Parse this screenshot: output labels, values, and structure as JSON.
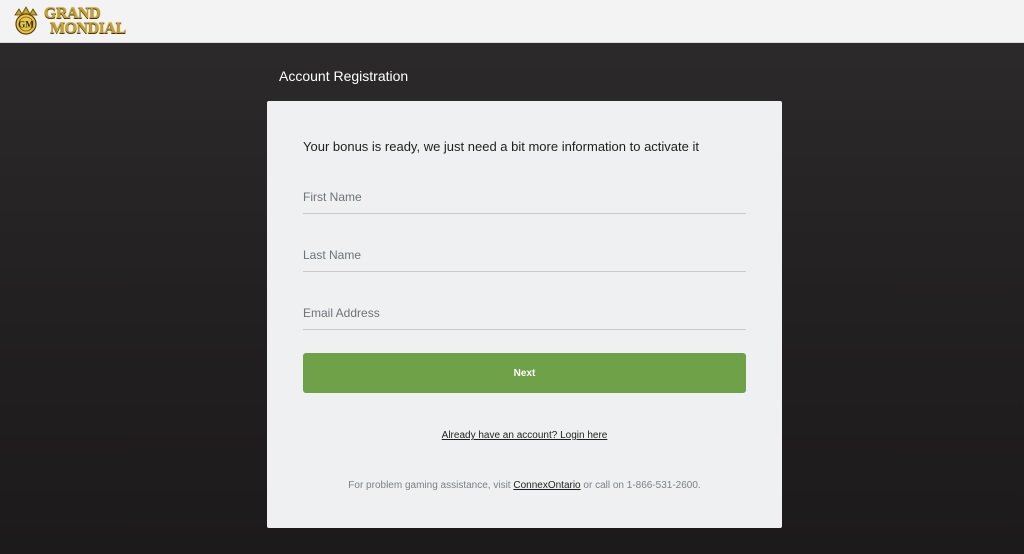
{
  "brand": {
    "logo_line1": "GRAND",
    "logo_line2": "MONDIAL",
    "gold_color": "#c9a227"
  },
  "page": {
    "heading": "Account Registration"
  },
  "form": {
    "intro": "Your bonus is ready, we just need a bit more information to activate it",
    "first_name_placeholder": "First Name",
    "first_name_value": "",
    "last_name_placeholder": "Last Name",
    "last_name_value": "",
    "email_placeholder": "Email Address",
    "email_value": "",
    "next_label": "Next",
    "next_color": "#6fa149",
    "login_link": "Already have an account? Login here"
  },
  "footer": {
    "prefix": "For problem gaming assistance, visit ",
    "link": "ConnexOntario",
    "suffix": " or call on 1-866-531-2600."
  }
}
